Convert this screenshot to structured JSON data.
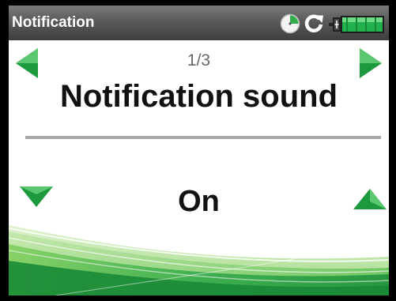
{
  "header": {
    "title": "Notification",
    "status_icons": [
      "timer-icon",
      "refresh-icon",
      "battery-icon"
    ],
    "battery_color": "#22b14c"
  },
  "setting": {
    "page": "1/3",
    "title": "Notification sound",
    "value": "On"
  },
  "colors": {
    "accent_green": "#22a044",
    "titlebar": "#5a5a5a",
    "background": "#ffffff"
  }
}
